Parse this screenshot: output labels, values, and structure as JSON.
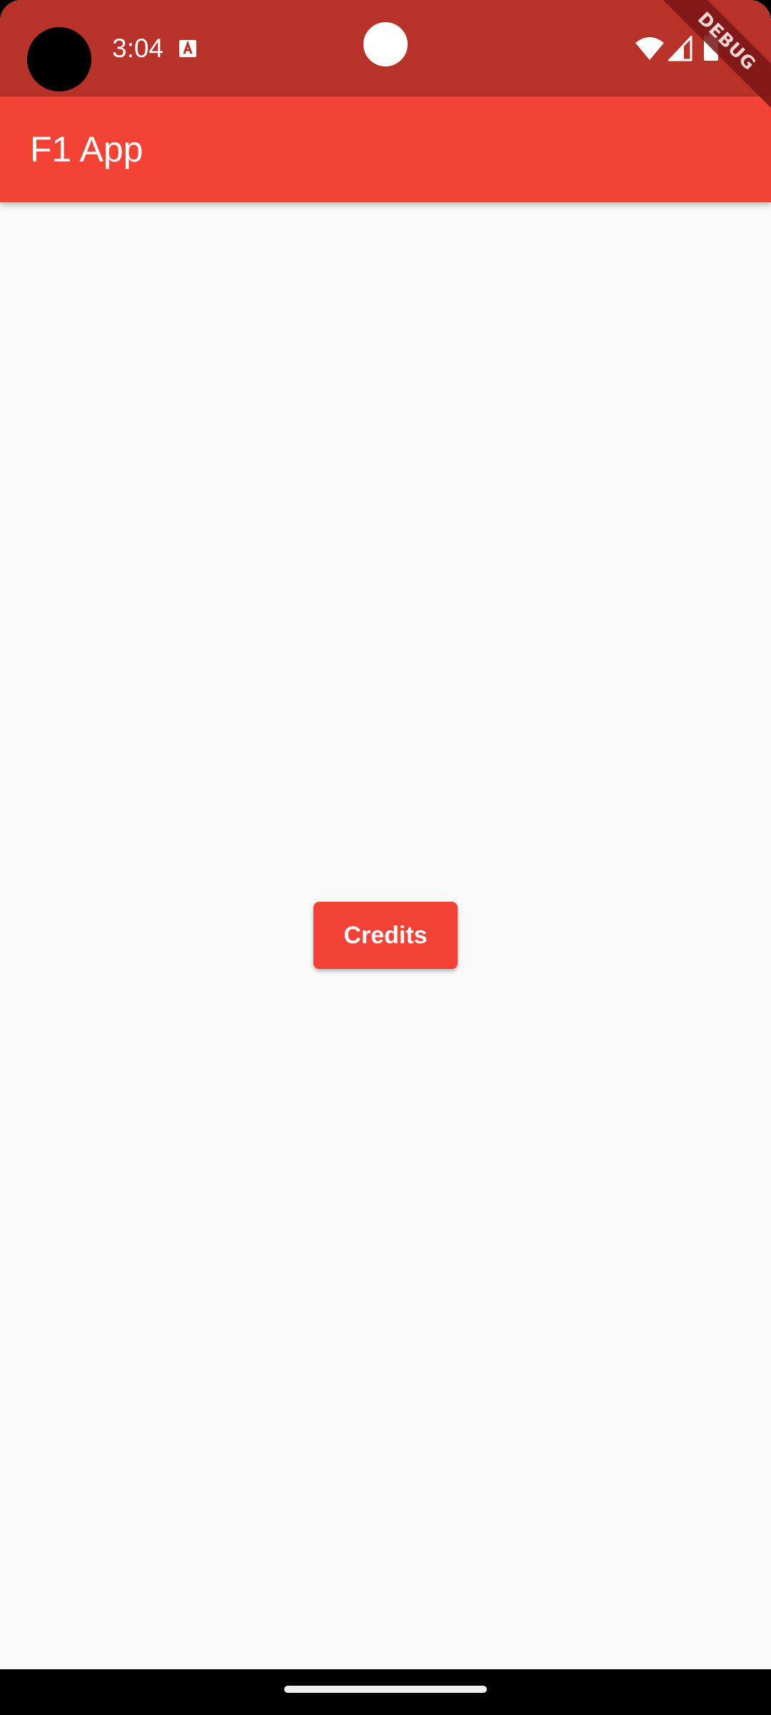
{
  "status_bar": {
    "time": "3:04",
    "icons": [
      "camera-cutout",
      "text-a-notification-icon",
      "front-sensor",
      "wifi-icon",
      "cell-signal-icon",
      "battery-icon"
    ],
    "background_color": "#b83229"
  },
  "debug_banner": {
    "label": "DEBUG"
  },
  "app_bar": {
    "title": "F1 App",
    "background_color": "#f44336"
  },
  "main": {
    "credits_button_label": "Credits",
    "background_color": "#fafafa"
  },
  "navigation_bar": {
    "handle": "home-handle"
  }
}
